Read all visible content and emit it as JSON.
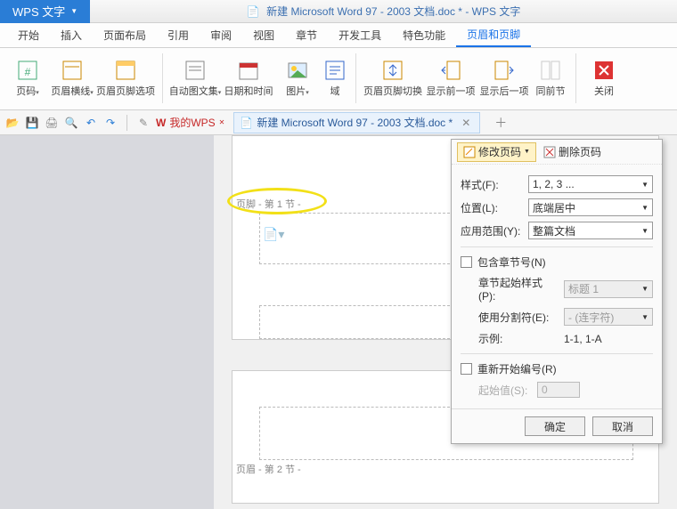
{
  "titlebar": {
    "app_name": "WPS 文字",
    "doc_title": "新建 Microsoft Word 97 - 2003 文档.doc * - WPS 文字"
  },
  "menu": {
    "items": [
      "开始",
      "插入",
      "页面布局",
      "引用",
      "审阅",
      "视图",
      "章节",
      "开发工具",
      "特色功能",
      "页眉和页脚"
    ],
    "active": 9
  },
  "ribbon": {
    "page_number": "页码",
    "header_line": "页眉横线",
    "hf_options": "页眉页脚选项",
    "auto_text": "自动图文集",
    "date_time": "日期和时间",
    "picture": "图片",
    "field": "域",
    "hf_switch": "页眉页脚切换",
    "show_prev": "显示前一项",
    "show_next": "显示后一项",
    "same_prev": "同前节",
    "close": "关闭"
  },
  "qat": {
    "mywps": "我的WPS",
    "doctab": "新建 Microsoft Word 97 - 2003 文档.doc *"
  },
  "work": {
    "footer_sec1": "页脚 - 第 1 节 -",
    "header_sec2": "页眉 - 第 2 节 -"
  },
  "dialog": {
    "modify": "修改页码",
    "delete": "删除页码",
    "style_label": "样式(F):",
    "style_value": "1, 2, 3 ...",
    "pos_label": "位置(L):",
    "pos_value": "底端居中",
    "range_label": "应用范围(Y):",
    "range_value": "整篇文档",
    "include_chapter": "包含章节号(N)",
    "chapter_style_label": "章节起始样式(P):",
    "chapter_style_value": "标题 1",
    "separator_label": "使用分割符(E):",
    "separator_value": "-  (连字符)",
    "example_label": "示例:",
    "example_value": "1-1, 1-A",
    "restart": "重新开始编号(R)",
    "start_label": "起始值(S):",
    "start_value": "0",
    "ok": "确定",
    "cancel": "取消"
  }
}
